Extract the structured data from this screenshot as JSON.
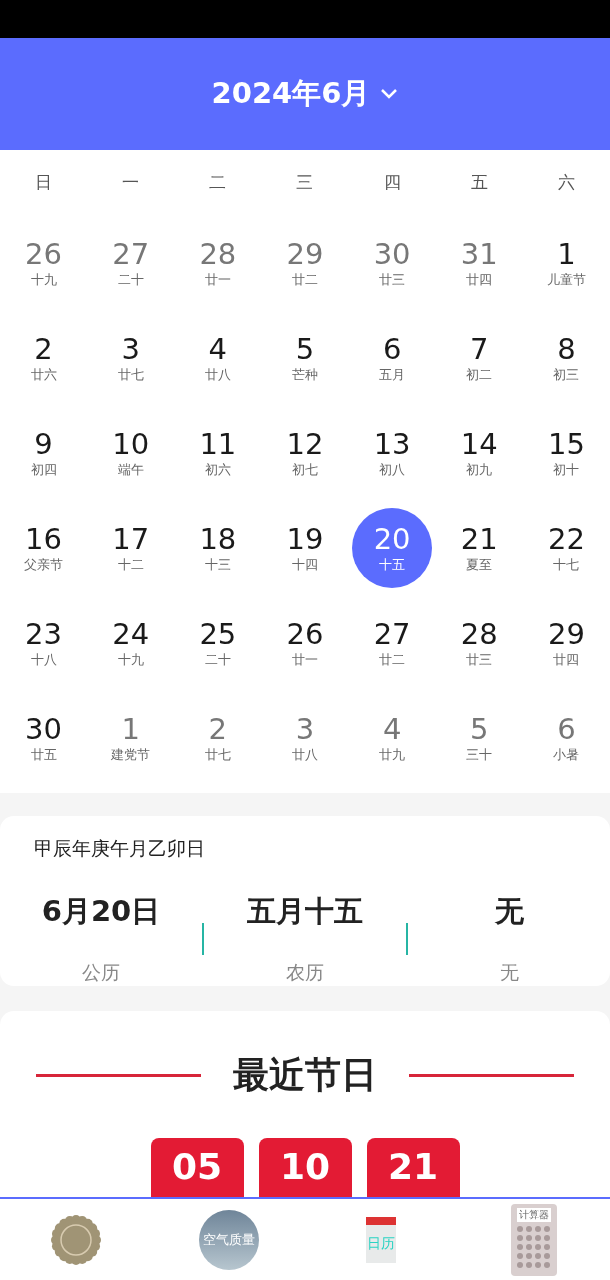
{
  "header": {
    "title": "2024年6月"
  },
  "weekdays": [
    "日",
    "一",
    "二",
    "三",
    "四",
    "五",
    "六"
  ],
  "weeks": [
    [
      {
        "day": "26",
        "lunar": "十九",
        "in_month": false,
        "selected": false
      },
      {
        "day": "27",
        "lunar": "二十",
        "in_month": false,
        "selected": false
      },
      {
        "day": "28",
        "lunar": "廿一",
        "in_month": false,
        "selected": false
      },
      {
        "day": "29",
        "lunar": "廿二",
        "in_month": false,
        "selected": false
      },
      {
        "day": "30",
        "lunar": "廿三",
        "in_month": false,
        "selected": false
      },
      {
        "day": "31",
        "lunar": "廿四",
        "in_month": false,
        "selected": false
      },
      {
        "day": "1",
        "lunar": "儿童节",
        "in_month": true,
        "selected": false
      }
    ],
    [
      {
        "day": "2",
        "lunar": "廿六",
        "in_month": true,
        "selected": false
      },
      {
        "day": "3",
        "lunar": "廿七",
        "in_month": true,
        "selected": false
      },
      {
        "day": "4",
        "lunar": "廿八",
        "in_month": true,
        "selected": false
      },
      {
        "day": "5",
        "lunar": "芒种",
        "in_month": true,
        "selected": false
      },
      {
        "day": "6",
        "lunar": "五月",
        "in_month": true,
        "selected": false
      },
      {
        "day": "7",
        "lunar": "初二",
        "in_month": true,
        "selected": false
      },
      {
        "day": "8",
        "lunar": "初三",
        "in_month": true,
        "selected": false
      }
    ],
    [
      {
        "day": "9",
        "lunar": "初四",
        "in_month": true,
        "selected": false
      },
      {
        "day": "10",
        "lunar": "端午",
        "in_month": true,
        "selected": false
      },
      {
        "day": "11",
        "lunar": "初六",
        "in_month": true,
        "selected": false
      },
      {
        "day": "12",
        "lunar": "初七",
        "in_month": true,
        "selected": false
      },
      {
        "day": "13",
        "lunar": "初八",
        "in_month": true,
        "selected": false
      },
      {
        "day": "14",
        "lunar": "初九",
        "in_month": true,
        "selected": false
      },
      {
        "day": "15",
        "lunar": "初十",
        "in_month": true,
        "selected": false
      }
    ],
    [
      {
        "day": "16",
        "lunar": "父亲节",
        "in_month": true,
        "selected": false
      },
      {
        "day": "17",
        "lunar": "十二",
        "in_month": true,
        "selected": false
      },
      {
        "day": "18",
        "lunar": "十三",
        "in_month": true,
        "selected": false
      },
      {
        "day": "19",
        "lunar": "十四",
        "in_month": true,
        "selected": false
      },
      {
        "day": "20",
        "lunar": "十五",
        "in_month": true,
        "selected": true
      },
      {
        "day": "21",
        "lunar": "夏至",
        "in_month": true,
        "selected": false
      },
      {
        "day": "22",
        "lunar": "十七",
        "in_month": true,
        "selected": false
      }
    ],
    [
      {
        "day": "23",
        "lunar": "十八",
        "in_month": true,
        "selected": false
      },
      {
        "day": "24",
        "lunar": "十九",
        "in_month": true,
        "selected": false
      },
      {
        "day": "25",
        "lunar": "二十",
        "in_month": true,
        "selected": false
      },
      {
        "day": "26",
        "lunar": "廿一",
        "in_month": true,
        "selected": false
      },
      {
        "day": "27",
        "lunar": "廿二",
        "in_month": true,
        "selected": false
      },
      {
        "day": "28",
        "lunar": "廿三",
        "in_month": true,
        "selected": false
      },
      {
        "day": "29",
        "lunar": "廿四",
        "in_month": true,
        "selected": false
      }
    ],
    [
      {
        "day": "30",
        "lunar": "廿五",
        "in_month": true,
        "selected": false
      },
      {
        "day": "1",
        "lunar": "建党节",
        "in_month": false,
        "selected": false
      },
      {
        "day": "2",
        "lunar": "廿七",
        "in_month": false,
        "selected": false
      },
      {
        "day": "3",
        "lunar": "廿八",
        "in_month": false,
        "selected": false
      },
      {
        "day": "4",
        "lunar": "廿九",
        "in_month": false,
        "selected": false
      },
      {
        "day": "5",
        "lunar": "三十",
        "in_month": false,
        "selected": false
      },
      {
        "day": "6",
        "lunar": "小暑",
        "in_month": false,
        "selected": false
      }
    ]
  ],
  "info": {
    "ganzhi": "甲辰年庚午月乙卯日",
    "columns": [
      {
        "value": "6月20日",
        "label": "公历"
      },
      {
        "value": "五月十五",
        "label": "农历"
      },
      {
        "value": "无",
        "label": "无"
      }
    ]
  },
  "holidays": {
    "title": "最近节日",
    "countdown": [
      "05",
      "10",
      "21"
    ]
  },
  "bottom_nav": [
    {
      "kind": "seal"
    },
    {
      "kind": "air",
      "text": "空气质量"
    },
    {
      "kind": "calendar",
      "text": "日历"
    },
    {
      "kind": "calculator",
      "text": "计算器"
    }
  ]
}
